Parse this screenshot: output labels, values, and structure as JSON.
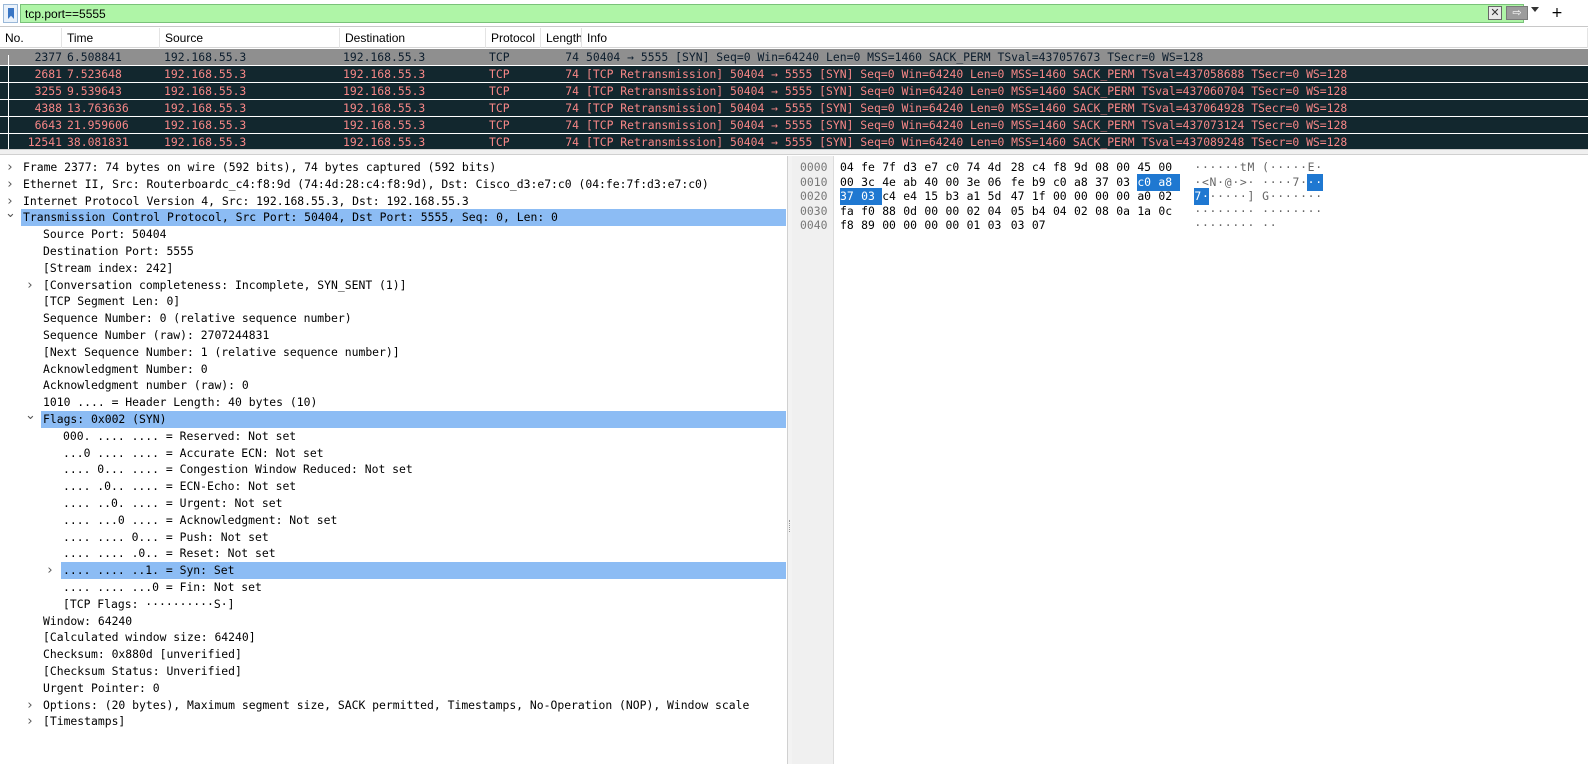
{
  "filter": {
    "value": "tcp.port==5555",
    "clear_icon": "x-icon",
    "apply_icon": "arrow-right-icon",
    "plus_label": "+"
  },
  "packet_list": {
    "columns": [
      "No.",
      "Time",
      "Source",
      "Destination",
      "Protocol",
      "Length",
      "Info"
    ],
    "rows": [
      {
        "no": "2377",
        "time": "6.508841",
        "src": "192.168.55.3",
        "dst": "192.168.55.3",
        "proto": "TCP",
        "len": "74",
        "info": "50404 → 5555 [SYN] Seq=0 Win=64240 Len=0 MSS=1460 SACK_PERM TSval=437057673 TSecr=0 WS=128",
        "style": "sel"
      },
      {
        "no": "2681",
        "time": "7.523648",
        "src": "192.168.55.3",
        "dst": "192.168.55.3",
        "proto": "TCP",
        "len": "74",
        "info": "[TCP Retransmission] 50404 → 5555 [SYN] Seq=0 Win=64240 Len=0 MSS=1460 SACK_PERM TSval=437058688 TSecr=0 WS=128",
        "style": "bad"
      },
      {
        "no": "3255",
        "time": "9.539643",
        "src": "192.168.55.3",
        "dst": "192.168.55.3",
        "proto": "TCP",
        "len": "74",
        "info": "[TCP Retransmission] 50404 → 5555 [SYN] Seq=0 Win=64240 Len=0 MSS=1460 SACK_PERM TSval=437060704 TSecr=0 WS=128",
        "style": "bad"
      },
      {
        "no": "4388",
        "time": "13.763636",
        "src": "192.168.55.3",
        "dst": "192.168.55.3",
        "proto": "TCP",
        "len": "74",
        "info": "[TCP Retransmission] 50404 → 5555 [SYN] Seq=0 Win=64240 Len=0 MSS=1460 SACK_PERM TSval=437064928 TSecr=0 WS=128",
        "style": "bad"
      },
      {
        "no": "6643",
        "time": "21.959606",
        "src": "192.168.55.3",
        "dst": "192.168.55.3",
        "proto": "TCP",
        "len": "74",
        "info": "[TCP Retransmission] 50404 → 5555 [SYN] Seq=0 Win=64240 Len=0 MSS=1460 SACK_PERM TSval=437073124 TSecr=0 WS=128",
        "style": "bad"
      },
      {
        "no": "12541",
        "time": "38.081831",
        "src": "192.168.55.3",
        "dst": "192.168.55.3",
        "proto": "TCP",
        "len": "74",
        "info": "[TCP Retransmission] 50404 → 5555 [SYN] Seq=0 Win=64240 Len=0 MSS=1460 SACK_PERM TSval=437089248 TSecr=0 WS=128",
        "style": "bad"
      }
    ]
  },
  "details": [
    {
      "level": 0,
      "arrow": "collapsed",
      "text": "Frame 2377: 74 bytes on wire (592 bits), 74 bytes captured (592 bits)",
      "hl": false
    },
    {
      "level": 0,
      "arrow": "collapsed",
      "text": "Ethernet II, Src: Routerboardc_c4:f8:9d (74:4d:28:c4:f8:9d), Dst: Cisco_d3:e7:c0 (04:fe:7f:d3:e7:c0)",
      "hl": false
    },
    {
      "level": 0,
      "arrow": "collapsed",
      "text": "Internet Protocol Version 4, Src: 192.168.55.3, Dst: 192.168.55.3",
      "hl": false
    },
    {
      "level": 0,
      "arrow": "expanded",
      "text": "Transmission Control Protocol, Src Port: 50404, Dst Port: 5555, Seq: 0, Len: 0",
      "hl": true
    },
    {
      "level": 1,
      "arrow": "none",
      "text": "Source Port: 50404",
      "hl": false
    },
    {
      "level": 1,
      "arrow": "none",
      "text": "Destination Port: 5555",
      "hl": false
    },
    {
      "level": 1,
      "arrow": "none",
      "text": "[Stream index: 242]",
      "hl": false
    },
    {
      "level": 1,
      "arrow": "collapsed",
      "text": "[Conversation completeness: Incomplete, SYN_SENT (1)]",
      "hl": false
    },
    {
      "level": 1,
      "arrow": "none",
      "text": "[TCP Segment Len: 0]",
      "hl": false
    },
    {
      "level": 1,
      "arrow": "none",
      "text": "Sequence Number: 0    (relative sequence number)",
      "hl": false
    },
    {
      "level": 1,
      "arrow": "none",
      "text": "Sequence Number (raw): 2707244831",
      "hl": false
    },
    {
      "level": 1,
      "arrow": "none",
      "text": "[Next Sequence Number: 1    (relative sequence number)]",
      "hl": false
    },
    {
      "level": 1,
      "arrow": "none",
      "text": "Acknowledgment Number: 0",
      "hl": false
    },
    {
      "level": 1,
      "arrow": "none",
      "text": "Acknowledgment number (raw): 0",
      "hl": false
    },
    {
      "level": 1,
      "arrow": "none",
      "text": "1010 .... = Header Length: 40 bytes (10)",
      "hl": false
    },
    {
      "level": 1,
      "arrow": "expanded",
      "text": "Flags: 0x002 (SYN)",
      "hl": true
    },
    {
      "level": 2,
      "arrow": "none",
      "text": "000. .... .... = Reserved: Not set",
      "hl": false
    },
    {
      "level": 2,
      "arrow": "none",
      "text": "...0 .... .... = Accurate ECN: Not set",
      "hl": false
    },
    {
      "level": 2,
      "arrow": "none",
      "text": ".... 0... .... = Congestion Window Reduced: Not set",
      "hl": false
    },
    {
      "level": 2,
      "arrow": "none",
      "text": ".... .0.. .... = ECN-Echo: Not set",
      "hl": false
    },
    {
      "level": 2,
      "arrow": "none",
      "text": ".... ..0. .... = Urgent: Not set",
      "hl": false
    },
    {
      "level": 2,
      "arrow": "none",
      "text": ".... ...0 .... = Acknowledgment: Not set",
      "hl": false
    },
    {
      "level": 2,
      "arrow": "none",
      "text": ".... .... 0... = Push: Not set",
      "hl": false
    },
    {
      "level": 2,
      "arrow": "none",
      "text": ".... .... .0.. = Reset: Not set",
      "hl": false
    },
    {
      "level": 2,
      "arrow": "collapsed",
      "text": ".... .... ..1. = Syn: Set",
      "hl": true
    },
    {
      "level": 2,
      "arrow": "none",
      "text": ".... .... ...0 = Fin: Not set",
      "hl": false
    },
    {
      "level": 2,
      "arrow": "none",
      "text": "[TCP Flags: ··········S·]",
      "hl": false
    },
    {
      "level": 1,
      "arrow": "none",
      "text": "Window: 64240",
      "hl": false
    },
    {
      "level": 1,
      "arrow": "none",
      "text": "[Calculated window size: 64240]",
      "hl": false
    },
    {
      "level": 1,
      "arrow": "none",
      "text": "Checksum: 0x880d [unverified]",
      "hl": false
    },
    {
      "level": 1,
      "arrow": "none",
      "text": "[Checksum Status: Unverified]",
      "hl": false
    },
    {
      "level": 1,
      "arrow": "none",
      "text": "Urgent Pointer: 0",
      "hl": false
    },
    {
      "level": 1,
      "arrow": "collapsed",
      "text": "Options: (20 bytes), Maximum segment size, SACK permitted, Timestamps, No-Operation (NOP), Window scale",
      "hl": false
    },
    {
      "level": 1,
      "arrow": "collapsed",
      "text": "[Timestamps]",
      "hl": false
    }
  ],
  "bytes": [
    {
      "offset": "0000",
      "hex": [
        "04",
        "fe",
        "7f",
        "d3",
        "e7",
        "c0",
        "74",
        "4d",
        "28",
        "c4",
        "f8",
        "9d",
        "08",
        "00",
        "45",
        "00"
      ],
      "ascii": [
        "·",
        "·",
        "·",
        "·",
        "·",
        "·",
        "t",
        "M",
        "(",
        "·",
        "·",
        "·",
        "·",
        "·",
        "E",
        "·"
      ],
      "sel": []
    },
    {
      "offset": "0010",
      "hex": [
        "00",
        "3c",
        "4e",
        "ab",
        "40",
        "00",
        "3e",
        "06",
        "fe",
        "b9",
        "c0",
        "a8",
        "37",
        "03",
        "c0",
        "a8"
      ],
      "ascii": [
        "·",
        "<",
        "N",
        "·",
        "@",
        "·",
        ">",
        "·",
        "·",
        "·",
        "·",
        "·",
        "7",
        "·",
        "·",
        "·"
      ],
      "sel": [
        14,
        15
      ]
    },
    {
      "offset": "0020",
      "hex": [
        "37",
        "03",
        "c4",
        "e4",
        "15",
        "b3",
        "a1",
        "5d",
        "47",
        "1f",
        "00",
        "00",
        "00",
        "00",
        "a0",
        "02"
      ],
      "ascii": [
        "7",
        "·",
        "·",
        "·",
        "·",
        "·",
        "·",
        "]",
        "G",
        "·",
        "·",
        "·",
        "·",
        "·",
        "·",
        "·"
      ],
      "sel": [
        0,
        1
      ]
    },
    {
      "offset": "0030",
      "hex": [
        "fa",
        "f0",
        "88",
        "0d",
        "00",
        "00",
        "02",
        "04",
        "05",
        "b4",
        "04",
        "02",
        "08",
        "0a",
        "1a",
        "0c"
      ],
      "ascii": [
        "·",
        "·",
        "·",
        "·",
        "·",
        "·",
        "·",
        "·",
        "·",
        "·",
        "·",
        "·",
        "·",
        "·",
        "·",
        "·"
      ],
      "sel": []
    },
    {
      "offset": "0040",
      "hex": [
        "f8",
        "89",
        "00",
        "00",
        "00",
        "00",
        "01",
        "03",
        "03",
        "07"
      ],
      "ascii": [
        "·",
        "·",
        "·",
        "·",
        "·",
        "·",
        "·",
        "·",
        "·",
        "·"
      ],
      "sel": []
    }
  ]
}
